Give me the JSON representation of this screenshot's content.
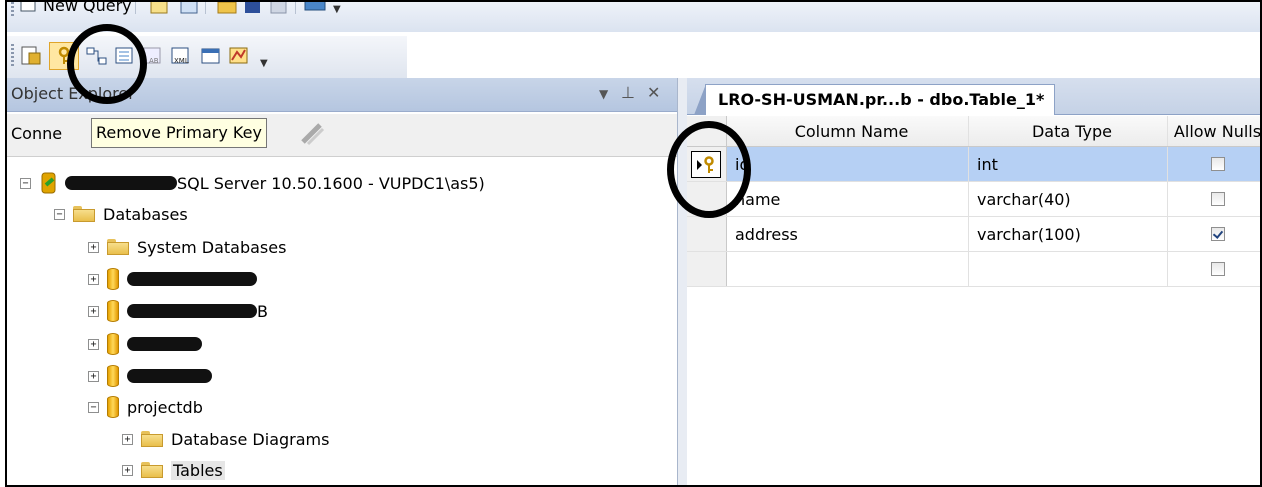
{
  "toolbar_top": {
    "new_query_label": "New Query"
  },
  "toolbar_designer": {
    "buttons": [
      "generate-change-script",
      "set-primary-key",
      "relationships",
      "manage-indexes",
      "manage-fulltext",
      "manage-xml-indexes",
      "manage-check-constraints",
      "manage-spatial-indexes"
    ]
  },
  "object_explorer": {
    "title": "Object Explorer",
    "pin_glyph": "↓ ⨅",
    "close_glyph": "✕",
    "connect_label": "Conne",
    "tooltip": "Remove Primary Key",
    "tree": {
      "server_suffix": "SQL Server 10.50.1600 - VUPDC1\\as5)",
      "databases": "Databases",
      "system_databases": "System Databases",
      "redacted_db_suffixes": [
        "",
        "B",
        "",
        ""
      ],
      "projectdb": "projectdb",
      "database_diagrams": "Database Diagrams",
      "tables": "Tables"
    }
  },
  "designer": {
    "tab_title": "LRO-SH-USMAN.pr...b - dbo.Table_1*",
    "columns_header": [
      "Column Name",
      "Data Type",
      "Allow Nulls"
    ],
    "rows": [
      {
        "name": "id",
        "type": "int",
        "allow_nulls": false,
        "primary_key": true,
        "selected": true
      },
      {
        "name": "name",
        "type": "varchar(40)",
        "allow_nulls": false
      },
      {
        "name": "address",
        "type": "varchar(100)",
        "allow_nulls": true
      },
      {
        "name": "",
        "type": "",
        "allow_nulls": false
      }
    ]
  }
}
